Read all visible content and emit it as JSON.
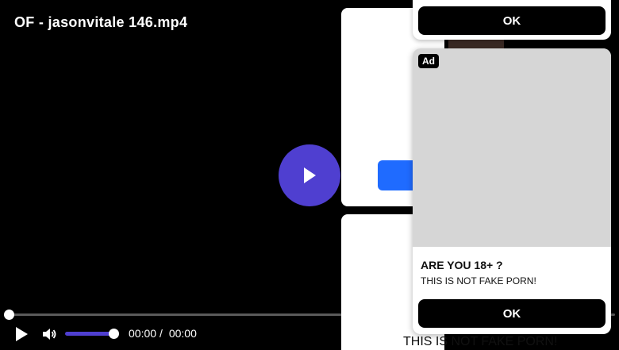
{
  "player": {
    "title": "OF - jasonvitale 146.mp4",
    "current_time": "00:00",
    "separator": "/",
    "duration": "00:00",
    "progress": 0,
    "volume": 1.0,
    "accent_color": "#4f3fd0"
  },
  "ads": {
    "top_card": {
      "ok_label": "OK"
    },
    "main_card": {
      "badge": "Ad",
      "headline": "ARE YOU 18+ ?",
      "subtext": "THIS IS NOT FAKE PORN!",
      "ok_label": "OK"
    },
    "behind_text": "THIS IS NOT FAKE PORN!"
  },
  "icons": {
    "big_play": "play-icon",
    "control_play": "play-icon",
    "volume": "volume-icon"
  }
}
